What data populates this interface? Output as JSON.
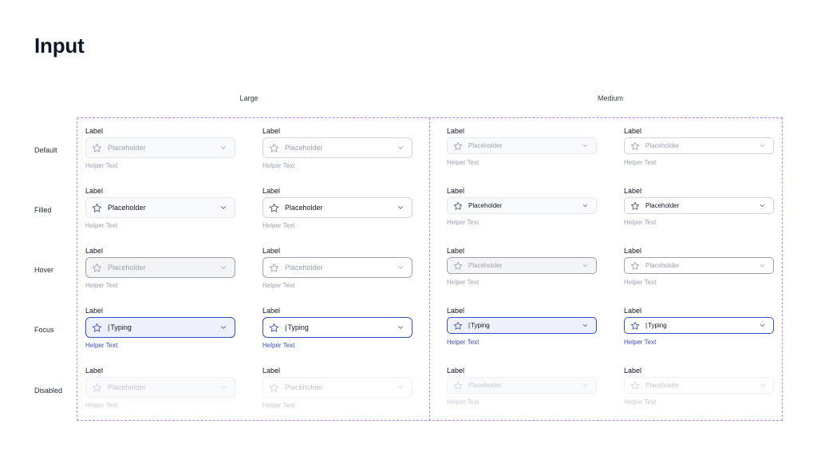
{
  "page": {
    "title": "Input"
  },
  "columns": {
    "large": "Large",
    "medium": "Medium"
  },
  "rows": [
    {
      "state": "default",
      "label": "Default",
      "value": "Placeholder"
    },
    {
      "state": "filled",
      "label": "Filled",
      "value": "Placeholder"
    },
    {
      "state": "hover",
      "label": "Hover",
      "value": "Placeholder"
    },
    {
      "state": "focus",
      "label": "Focus",
      "value": "Typing"
    },
    {
      "state": "disabled",
      "label": "Disabled",
      "value": "Placeholder"
    }
  ],
  "field": {
    "label": "Label",
    "helper": "Helper Text"
  },
  "icons": {
    "leading": "star-icon",
    "trailing": "chevron-down-icon"
  },
  "colors": {
    "focus_accent": "#3b4fc4",
    "frame_border": "#c084fc",
    "hover_border": "#9ca3af"
  }
}
